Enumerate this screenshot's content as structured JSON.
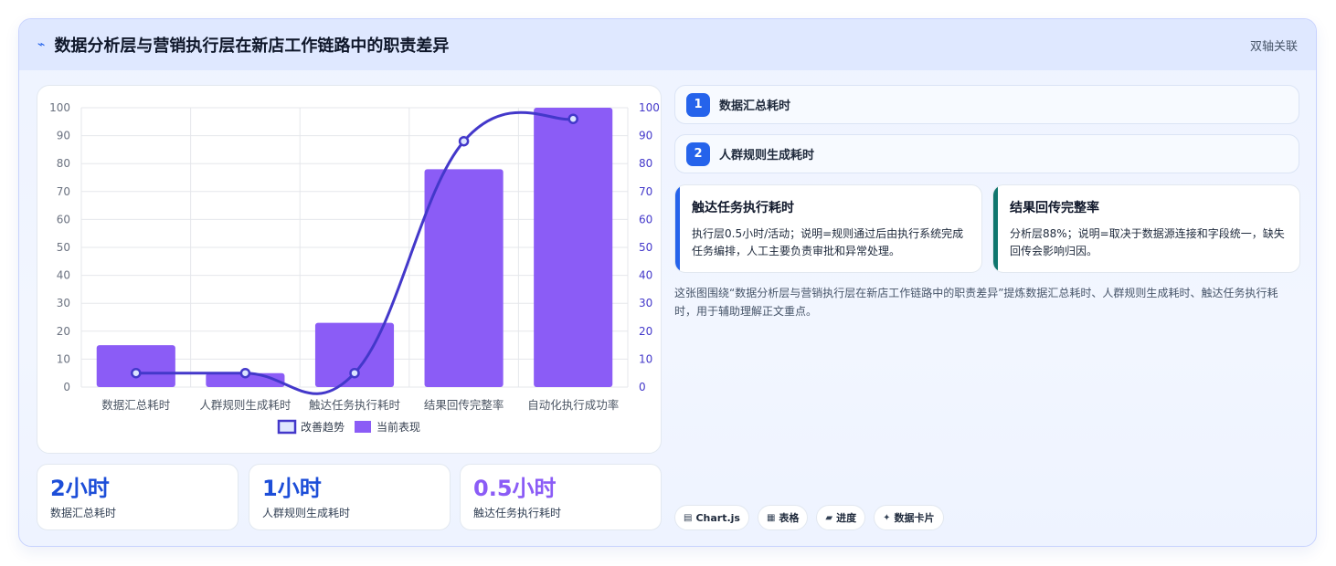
{
  "header": {
    "logo": "⌁",
    "title": "数据分析层与营销执行层在新店工作链路中的职责差异",
    "tag": "双轴关联"
  },
  "chart_data": {
    "type": "bar",
    "categories": [
      "数据汇总耗时",
      "人群规则生成耗时",
      "触达任务执行耗时",
      "结果回传完整率",
      "自动化执行成功率"
    ],
    "series": [
      {
        "name": "改善趋势",
        "type": "line",
        "axis": "right",
        "values": [
          5,
          5,
          5,
          88,
          96
        ],
        "color": "#4338ca"
      },
      {
        "name": "当前表现",
        "type": "bar",
        "axis": "left",
        "values": [
          15,
          5,
          23,
          78,
          100
        ],
        "color": "#8b5cf6"
      }
    ],
    "ylim": [
      0,
      100
    ],
    "y2lim": [
      0,
      100
    ],
    "yticks": [
      0,
      10,
      20,
      30,
      40,
      50,
      60,
      70,
      80,
      90,
      100
    ],
    "legend_position": "bottom",
    "grid": true
  },
  "stats": [
    {
      "value": "2小时",
      "label": "数据汇总耗时",
      "color": "#1d4ed8"
    },
    {
      "value": "1小时",
      "label": "人群规则生成耗时",
      "color": "#1d4ed8"
    },
    {
      "value": "0.5小时",
      "label": "触达任务执行耗时",
      "color": "#8b5cf6"
    }
  ],
  "steps": [
    {
      "num": "1",
      "label": "数据汇总耗时"
    },
    {
      "num": "2",
      "label": "人群规则生成耗时"
    }
  ],
  "details": [
    {
      "title": "触达任务执行耗时",
      "text": "执行层0.5小时/活动；说明=规则通过后由执行系统完成任务编排，人工主要负责审批和异常处理。",
      "color": "#2563eb"
    },
    {
      "title": "结果回传完整率",
      "text": "分析层88%；说明=取决于数据源连接和字段统一，缺失回传会影响归因。",
      "color": "#0f766e"
    }
  ],
  "summary": "这张图围绕“数据分析层与营销执行层在新店工作链路中的职责差异”提炼数据汇总耗时、人群规则生成耗时、触达任务执行耗时，用于辅助理解正文重点。",
  "chips": [
    {
      "icon": "▤",
      "label": "Chart.js"
    },
    {
      "icon": "▦",
      "label": "表格"
    },
    {
      "icon": "▰",
      "label": "进度"
    },
    {
      "icon": "✦",
      "label": "数据卡片"
    }
  ]
}
